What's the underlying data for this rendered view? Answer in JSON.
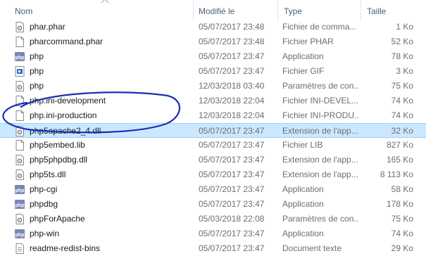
{
  "columns": {
    "name": "Nom",
    "date": "Modifié le",
    "type": "Type",
    "size": "Taille"
  },
  "files": [
    {
      "name": "phar.phar",
      "date": "05/07/2017 23:48",
      "type": "Fichier de comma...",
      "size": "1 Ko",
      "icon": "gear-doc-icon"
    },
    {
      "name": "pharcommand.phar",
      "date": "05/07/2017 23:48",
      "type": "Fichier PHAR",
      "size": "52 Ko",
      "icon": "doc-icon"
    },
    {
      "name": "php",
      "date": "05/07/2017 23:47",
      "type": "Application",
      "size": "78 Ko",
      "icon": "php-app-icon"
    },
    {
      "name": "php",
      "date": "05/07/2017 23:47",
      "type": "Fichier GIF",
      "size": "3 Ko",
      "icon": "gif-image-icon"
    },
    {
      "name": "php",
      "date": "12/03/2018 03:40",
      "type": "Paramètres de con...",
      "size": "75 Ko",
      "icon": "settings-doc-icon"
    },
    {
      "name": "php.ini-development",
      "date": "12/03/2018 22:04",
      "type": "Fichier INI-DEVEL...",
      "size": "74 Ko",
      "icon": "doc-icon"
    },
    {
      "name": "php.ini-production",
      "date": "12/03/2018 22:04",
      "type": "Fichier INI-PRODU...",
      "size": "74 Ko",
      "icon": "doc-icon"
    },
    {
      "name": "php5apache2_4.dll",
      "date": "05/07/2017 23:47",
      "type": "Extension de l'app...",
      "size": "32 Ko",
      "icon": "dll-icon",
      "selected": true
    },
    {
      "name": "php5embed.lib",
      "date": "05/07/2017 23:47",
      "type": "Fichier LIB",
      "size": "827 Ko",
      "icon": "doc-icon"
    },
    {
      "name": "php5phpdbg.dll",
      "date": "05/07/2017 23:47",
      "type": "Extension de l'app...",
      "size": "165 Ko",
      "icon": "dll-icon"
    },
    {
      "name": "php5ts.dll",
      "date": "05/07/2017 23:47",
      "type": "Extension de l'app...",
      "size": "8 113 Ko",
      "icon": "dll-icon"
    },
    {
      "name": "php-cgi",
      "date": "05/07/2017 23:47",
      "type": "Application",
      "size": "58 Ko",
      "icon": "php-app-icon"
    },
    {
      "name": "phpdbg",
      "date": "05/07/2017 23:47",
      "type": "Application",
      "size": "178 Ko",
      "icon": "php-app-icon"
    },
    {
      "name": "phpForApache",
      "date": "05/03/2018 22:08",
      "type": "Paramètres de con...",
      "size": "75 Ko",
      "icon": "settings-doc-icon"
    },
    {
      "name": "php-win",
      "date": "05/07/2017 23:47",
      "type": "Application",
      "size": "74 Ko",
      "icon": "php-app-icon"
    },
    {
      "name": "readme-redist-bins",
      "date": "05/07/2017 23:47",
      "type": "Document texte",
      "size": "29 Ko",
      "icon": "text-doc-icon"
    }
  ],
  "colors": {
    "selection_bg": "#cce8ff",
    "selection_border": "#99d1ff",
    "header_text": "#4c607a",
    "annotation_ink": "#1a2fb8",
    "php_icon": "#7a86b8"
  }
}
